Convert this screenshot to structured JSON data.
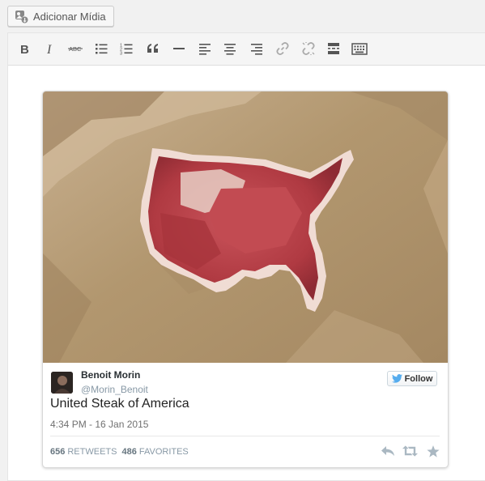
{
  "media_button": {
    "label": "Adicionar Mídia",
    "icon": "add-media-icon"
  },
  "toolbar": {
    "buttons": [
      {
        "name": "bold",
        "icon": "bold-icon"
      },
      {
        "name": "italic",
        "icon": "italic-icon"
      },
      {
        "name": "strikethrough",
        "icon": "strikethrough-icon",
        "glyph_text": "ABC"
      },
      {
        "name": "bulleted-list",
        "icon": "bulleted-list-icon"
      },
      {
        "name": "numbered-list",
        "icon": "numbered-list-icon"
      },
      {
        "name": "blockquote",
        "icon": "blockquote-icon"
      },
      {
        "name": "horizontal-line",
        "icon": "horizontal-line-icon"
      },
      {
        "name": "align-left",
        "icon": "align-left-icon"
      },
      {
        "name": "align-center",
        "icon": "align-center-icon"
      },
      {
        "name": "align-right",
        "icon": "align-right-icon"
      },
      {
        "name": "insert-link",
        "icon": "link-icon"
      },
      {
        "name": "remove-link",
        "icon": "unlink-icon"
      },
      {
        "name": "read-more",
        "icon": "read-more-icon"
      },
      {
        "name": "toolbar-toggle",
        "icon": "keyboard-icon"
      }
    ]
  },
  "tweet": {
    "image": "steak-shaped-like-usa-on-paper",
    "author_name": "Benoit Morin",
    "author_handle": "@Morin_Benoit",
    "follow_label": "Follow",
    "text": "United Steak of America",
    "timestamp": "4:34 PM - 16 Jan 2015",
    "retweets_count": "656",
    "retweets_label": "RETWEETS",
    "favorites_count": "486",
    "favorites_label": "FAVORITES",
    "actions": [
      "reply-icon",
      "retweet-icon",
      "favorite-icon"
    ]
  },
  "colors": {
    "twitter_blue": "#55acee",
    "toolbar_icon": "#555555",
    "meat_red": "#b33a3f",
    "paper": "#b69c78"
  }
}
